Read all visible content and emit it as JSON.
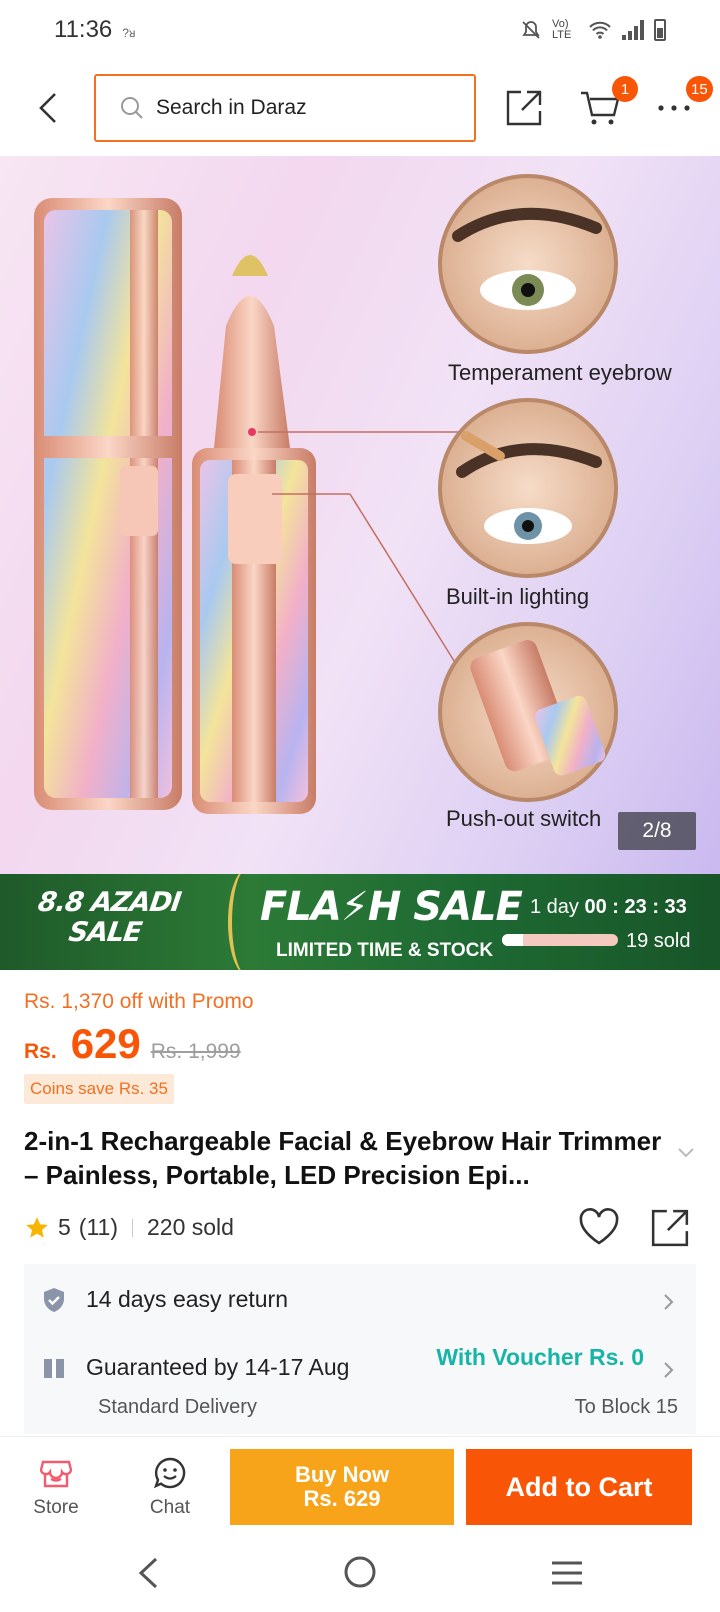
{
  "status_bar": {
    "time": "11:36",
    "mini": "? ",
    "network": "Vo) LTE"
  },
  "header": {
    "search_placeholder": "Search in Daraz",
    "cart_badge": "1",
    "more_badge": "15"
  },
  "gallery": {
    "captions": [
      "Temperament eyebrow",
      "Built-in lighting",
      "Push-out switch"
    ],
    "counter": "2/8"
  },
  "flash_sale": {
    "campaign": [
      "8.8 AZADI",
      "SALE"
    ],
    "title": "FLA⚡H SALE",
    "subtitle": "LIMITED TIME & STOCK",
    "days": "1 day",
    "timer": "00 : 23 : 33",
    "sold": "19 sold",
    "progress": 0.18
  },
  "pricing": {
    "promo_text": "Rs. 1,370 off with Promo",
    "currency": "Rs.",
    "price": "629",
    "original_price": "Rs. 1,999",
    "coins_text": "Coins save Rs. 35"
  },
  "product": {
    "title": "2-in-1 Rechargeable Facial & Eyebrow Hair Trimmer – Painless, Portable, LED Precision Epi...",
    "rating": "5",
    "reviews": "(11)",
    "sold": "220 sold"
  },
  "services": {
    "returns": "14 days easy return",
    "delivery_label": "Guaranteed by 14-17 Aug",
    "delivery_type": "Standard Delivery",
    "voucher": "With Voucher Rs. 0",
    "location": "To Block 15"
  },
  "bottom_bar": {
    "store": "Store",
    "chat": "Chat",
    "buy_now": "Buy Now",
    "buy_now_price": "Rs. 629",
    "add_to_cart": "Add to Cart"
  },
  "colors": {
    "accent": "#f85606",
    "buy_now": "#f8a41a",
    "voucher": "#16b5a5",
    "flash_bg": "#2c7a36"
  }
}
